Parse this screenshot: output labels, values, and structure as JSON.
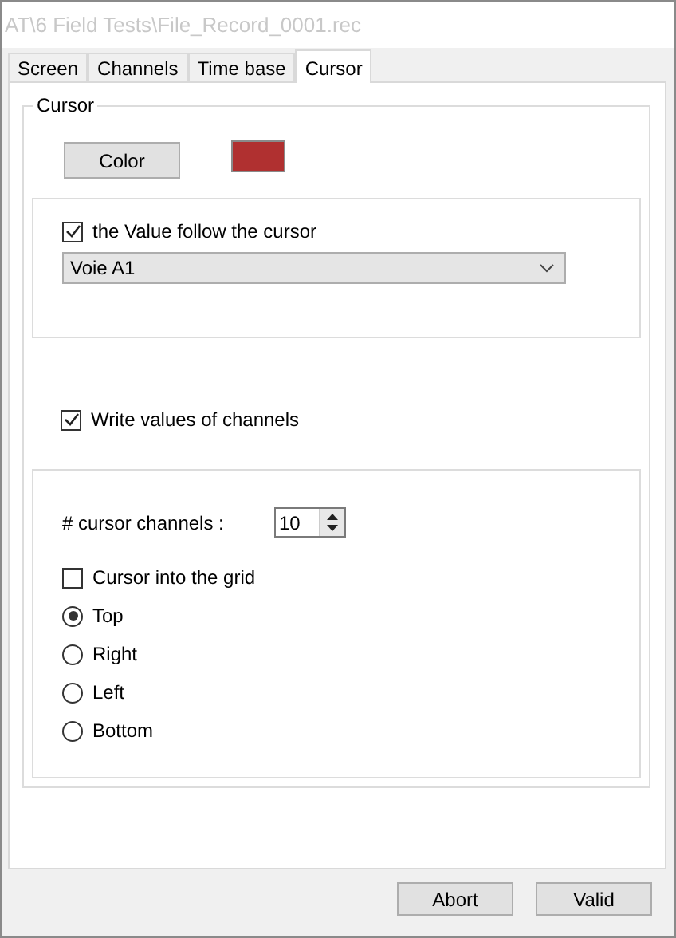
{
  "window": {
    "title": "AT\\6 Field Tests\\File_Record_0001.rec"
  },
  "tabs": [
    {
      "label": "Screen",
      "selected": false
    },
    {
      "label": "Channels",
      "selected": false
    },
    {
      "label": "Time base",
      "selected": false
    },
    {
      "label": "Cursor",
      "selected": true
    }
  ],
  "cursor_group": {
    "title": "Cursor",
    "color_button": "Color",
    "color": "#b03030",
    "follow_group": {
      "follow_checkbox": {
        "label": "the Value follow the cursor",
        "checked": true
      },
      "channel_dropdown": {
        "value": "Voie A1"
      }
    },
    "write_values_checkbox": {
      "label": "Write values of channels",
      "checked": true
    },
    "options_group": {
      "cursor_channels": {
        "label": "# cursor channels :",
        "value": "10"
      },
      "grid_checkbox": {
        "label": "Cursor into the grid",
        "checked": false
      },
      "positions": [
        {
          "label": "Top",
          "selected": true
        },
        {
          "label": "Right",
          "selected": false
        },
        {
          "label": "Left",
          "selected": false
        },
        {
          "label": "Bottom",
          "selected": false
        }
      ]
    }
  },
  "buttons": [
    "Abort",
    "Valid"
  ]
}
